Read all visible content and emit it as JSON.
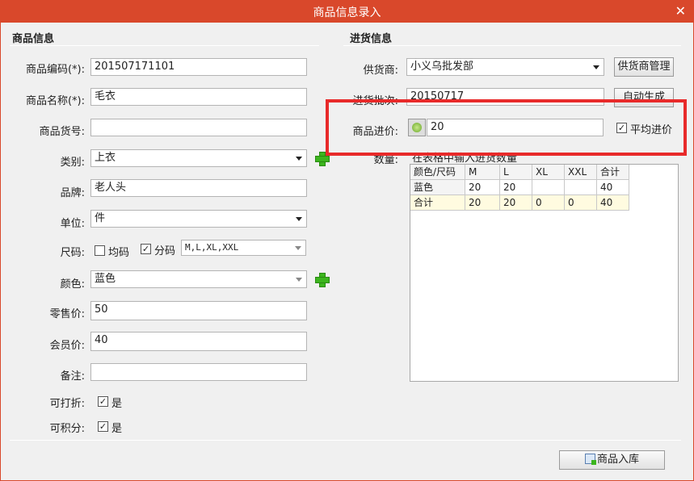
{
  "window": {
    "title": "商品信息录入",
    "close_glyph": "✕"
  },
  "left": {
    "section_title": "商品信息",
    "fields": {
      "code": {
        "label": "商品编码(*):",
        "value": "201507171101"
      },
      "name": {
        "label": "商品名称(*):",
        "value": "毛衣"
      },
      "sku": {
        "label": "商品货号:",
        "value": ""
      },
      "category": {
        "label": "类别:",
        "value": "上衣"
      },
      "brand": {
        "label": "品牌:",
        "value": "老人头"
      },
      "unit": {
        "label": "单位:",
        "value": "件"
      },
      "size": {
        "label": "尺码:",
        "uniform_label": "均码",
        "uniform_checked": false,
        "split_label": "分码",
        "split_checked": true,
        "split_value": "M,L,XL,XXL"
      },
      "color": {
        "label": "颜色:",
        "value": "蓝色"
      },
      "retail_price": {
        "label": "零售价:",
        "value": "50"
      },
      "member_price": {
        "label": "会员价:",
        "value": "40"
      },
      "remark": {
        "label": "备注:",
        "value": ""
      },
      "discountable": {
        "label": "可打折:",
        "checked": true,
        "text": "是"
      },
      "pointable": {
        "label": "可积分:",
        "checked": true,
        "text": "是"
      }
    }
  },
  "right": {
    "section_title": "进货信息",
    "supplier": {
      "label": "供货商:",
      "value": "小义乌批发部",
      "manage_button": "供货商管理"
    },
    "batch": {
      "label": "进货批次:",
      "value": "20150717",
      "auto_button": "自动生成"
    },
    "cost_price": {
      "label": "商品进价:",
      "value": "20",
      "avg_label": "平均进价",
      "avg_checked": true
    },
    "quantity": {
      "label": "数量:",
      "hint": "在表格中输入进货数量"
    },
    "table": {
      "headers": [
        "颜色/尺码",
        "M",
        "L",
        "XL",
        "XXL",
        "合计"
      ],
      "rows": [
        [
          "蓝色",
          "20",
          "20",
          "",
          "",
          "40"
        ],
        [
          "合计",
          "20",
          "20",
          "0",
          "0",
          "40"
        ]
      ]
    }
  },
  "footer": {
    "submit_button": "商品入库"
  },
  "colors": {
    "titlebar": "#d9482b",
    "highlight_box": "#e82a2a",
    "total_row": "#fffbe0"
  }
}
